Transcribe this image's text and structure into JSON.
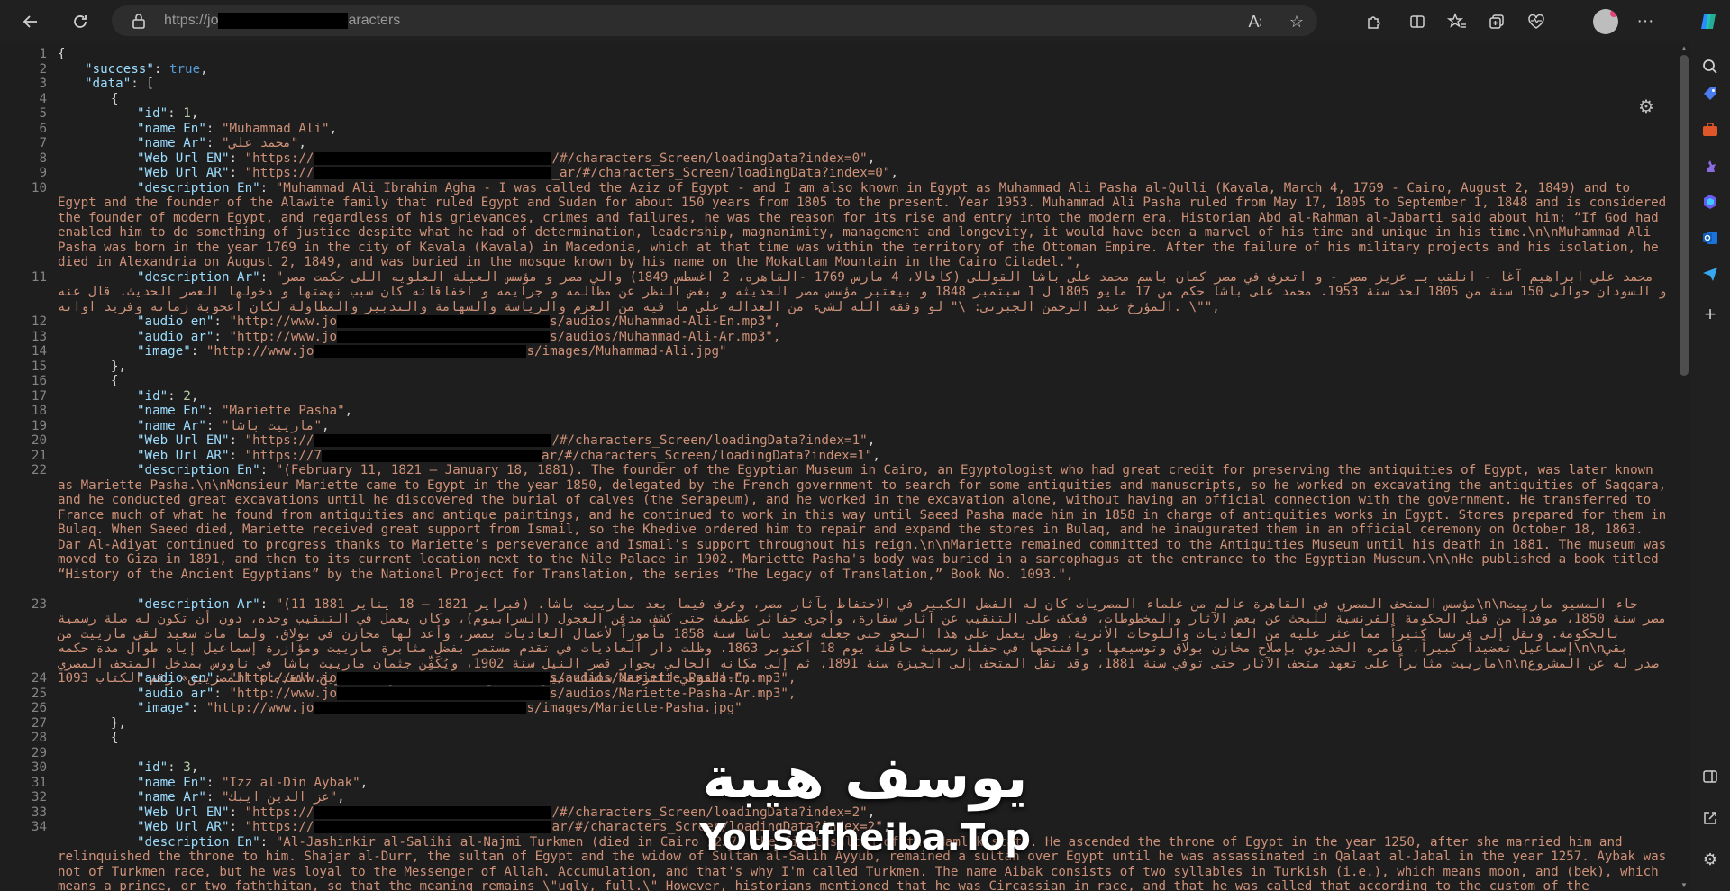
{
  "browser": {
    "url_prefix": "https://jo",
    "url_suffix": "aracters",
    "icons": {
      "back": "back-arrow-icon",
      "reload": "reload-icon",
      "lock": "lock-icon",
      "read_aloud": "read-aloud-icon",
      "favorite": "star-icon",
      "extensions": "puzzle-icon",
      "split": "split-screen-icon",
      "favorites": "favorites-icon",
      "collections": "collections-icon",
      "health": "browser-essentials-icon",
      "profile": "profile-avatar",
      "menu": "more-icon",
      "copilot": "copilot-icon"
    }
  },
  "sidebar": {
    "items": [
      "search-icon",
      "tag-icon",
      "briefcase-icon",
      "chess-icon",
      "copilot-app-icon",
      "outlook-icon",
      "send-icon",
      "add-icon"
    ],
    "bottom": [
      "sidebar-toggle-icon",
      "external-link-icon",
      "settings-icon"
    ]
  },
  "json_lines": {
    "l1": "{",
    "l2_key": "\"success\"",
    "l2_val": "true",
    "l3_key": "\"data\"",
    "l3_rest": "[",
    "l4": "{",
    "l5_key": "\"id\"",
    "l5_val": "1",
    "l6_key": "\"name En\"",
    "l6_val": "\"Muhammad Ali\"",
    "l7_key": "\"name Ar\"",
    "l7_val": "\"محمد علي\"",
    "l8_key": "\"Web Url EN\"",
    "l8_a": "\"https://",
    "l8_b": "/#/characters_Screen/loadingData?index=0\"",
    "l9_key": "\"Web Url AR\"",
    "l9_a": "\"https://",
    "l9_b": "_ar/#/characters_Screen/loadingData?index=0\"",
    "l10_key": "\"description En\"",
    "l10_val": "\"Muhammad Ali Ibrahim Agha - I was called the Aziz of Egypt - and I am also known in Egypt as Muhammad Ali Pasha al-Qulli (Kavala, March 4, 1769 - Cairo, August 2, 1849) and to Egypt and the founder of the Alawite family that ruled Egypt and Sudan for about 150 years from 1805 to the present. Year 1953. Muhammad Ali Pasha ruled from May 17, 1805 to September 1, 1848 and is considered the founder of modern Egypt, and regardless of his grievances, crimes and failures, he was the reason for its rise and entry into the modern era. Historian Abd al-Rahman al-Jabarti said about him: “If God had enabled him to do something of justice despite what he had of determination, leadership, magnanimity, management and longevity, it would have been a marvel of his time and unique in his time.\\n\\nMuhammad Ali Pasha was born in the year 1769 in the city of Kavala (Kavala) in Macedonia, which at that time was within the territory of the Ottoman Empire. After the failure of his military projects and his isolation, he died in Alexandria on August 2, 1849, and was buried in the mosque known by his name on the Mokattam Mountain in the Cairo Citadel.\",",
    "l11_key": "\"description Ar\"",
    "l11_val": "\"محمد علي ابراهيم آغا - انلقب بـ عزيز مصر - و اتعرف في مصر كمان باسم محمد على باشا القوللى (كافالا، 4 مارس 1769 -القاهره، 2 اغسطس 1849) والي مصر و مؤسس العيلة العلويه اللى حكمت مصر و السودان حوالى 150 سنة من 1805 لحد سنة 1953. محمد على باشا حكم من 17 مايو 1805 ل 1 سبتمبر 1848 و بيعتبر مؤسس مصر الحديثه و بغض النظر عن مظالمه و جرايمه و اخفاقاته كان سبب نهضتها و دخولها العصر الحديث. قال عنه المؤرخ عبد الرحمن الجبرتى: \\\" لو وفقه الله لشيء من العداله على ما فيه من العزم والرياسة والشهامة والتدبير والمطاولة لكان اعجوبة زمانه وفريد اوانه. \\\"\",",
    "l12_key": "\"audio en\"",
    "l12_a": "\"http://www.jo",
    "l12_b": "s/audios/Muhammad-Ali-En.mp3\",",
    "l13_key": "\"audio ar\"",
    "l13_a": "\"http://www.jo",
    "l13_b": "s/audios/Muhammad-Ali-Ar.mp3\",",
    "l14_key": "\"image\"",
    "l14_a": "\"http://www.jo",
    "l14_b": "s/images/Muhammad-Ali.jpg\"",
    "l15": "},",
    "l16": "{",
    "l17_key": "\"id\"",
    "l17_val": "2",
    "l18_key": "\"name En\"",
    "l18_val": "\"Mariette Pasha\"",
    "l19_key": "\"name Ar\"",
    "l19_val": "\"مارييت باشا\"",
    "l20_key": "\"Web Url EN\"",
    "l20_a": "\"https://",
    "l20_b": "/#/characters_Screen/loadingData?index=1\"",
    "l21_key": "\"Web Url AR\"",
    "l21_a": "\"https://7",
    "l21_b": "ar/#/characters_Screen/loadingData?index=1\"",
    "l22_key": "\"description En\"",
    "l22_val": "\"(February 11, 1821 – January 18, 1881). The founder of the Egyptian Museum in Cairo, an Egyptologist who had great credit for preserving the antiquities of Egypt, was later known as Mariette Pasha.\\n\\nMonsieur Mariette came to Egypt in the year 1850, delegated by the French government to search for some antiquities and manuscripts, so he worked on excavating the antiquities of Saqqara, and he conducted great excavations until he discovered the burial of calves (the Serapeum), and he worked in the excavation alone, without having an official connection with the government. He transferred to France much of what he found from antiquities and antique paintings, and he continued to work in this way until Saeed Pasha made him in 1858 in charge of antiquities works in Egypt. Stores prepared for them in Bulaq. When Saeed died, Mariette received great support from Ismail, so the Khedive ordered him to repair and expand the stores in Bulaq, and he inaugurated them in an official ceremony on October 18, 1863. Dar Al-Adiyat continued to progress thanks to Mariette’s perseverance and Ismail’s support throughout his reign.\\n\\nMariette remained committed to the Antiquities Museum until his death in 1881. The museum was moved to Giza in 1891, and then to its current location next to the Nile Palace in 1902. Mariette Pasha's body was buried in a sarcophagus at the entrance to the Egyptian Museum.\\n\\nHe published a book titled “History of the Ancient Egyptians” by the National Project for Translation, the series “The Legacy of Translation,” Book No. 1093.\",",
    "l23_key": "\"description Ar\"",
    "l23_val": "\"(11 فبراير 1821 – 18 يناير 1881) .مؤسس المتحف المصري في القاهرة عالم من علماء المصريات كان له الفضل الكبير في الاحتفاظ بآثار مصر، وعرف فيما بعد بمارييت باشا\\n\\nجاء المسيو مارييت مصر سنة 1850، موفداً من قبل الحكومة الفرنسية للبحث عن بعض الآثار والمخطوطات، فعكف على التنقيب عن آثار سقارة، وأجرى حفائر عظيمة حتى كشف مدفن العجول (السرابيوم)، وكان يعمل في التنقيب وحده، دون أن تكون له صلة رسمية بالحكومة. ونقل إلى فرنسا كثيراً مما عثر عليه من العاديات واللوحات الأثرية، وظل يعمل على هذا النحو حتى جعله سعيد باشا سنة 1858 مأموراً لأعمال العاديات بمصر، وأعد لها مخازن في بولاق. ولما مات سعيد لقي مارييت من إسماعيل تعضيداً كبيراً، فأمره الخديوي بإصلاح مخازن بولاق وتوسيعها، وافتتحها في حفلة رسمية حافلة يوم 18 أكتوبر 1863. وظلت دار العاديات في تقدم مستمر بفضل مثابرة مارييت ومؤازرة إسماعيل إياه طوال مدة حكمه\\n\\nبقي مارييت مثابراً على تعهد متحف الآثار حتى توفي سنة 1881، وقد نقل المتحف إلى الجيزة سنة 1891، ثم إلى مكانه الحالي بجوار قصر النيل سنة 1902، ويُكَفِّن جثمان مارييت باشا في ناووس بمدخل المتحف المصري\\n\\nصدر له عن المشروع القومي للترجمة سلسلة ميراث الترجمة كتاب بعنوان «تاريخ القدماء المصريين» رقم الكتاب 1093.\",",
    "l24_key": "\"audio en\"",
    "l24_a": "\"http://www.jo",
    "l24_b": "s/audios/Mariette-Pasha-En.mp3\",",
    "l25_key": "\"audio ar\"",
    "l25_a": "\"http://www.jo",
    "l25_b": "s/audios/Mariette-Pasha-Ar.mp3\",",
    "l26_key": "\"image\"",
    "l26_a": "\"http://www.jo",
    "l26_b": "s/images/Mariette-Pasha.jpg\"",
    "l27": "},",
    "l28": "{",
    "l30_key": "\"id\"",
    "l30_val": "3",
    "l31_key": "\"name En\"",
    "l31_val": "\"Izz al-Din Aybak\"",
    "l32_key": "\"name Ar\"",
    "l32_val": "\"عز الدين ايبك\"",
    "l33_key": "\"Web Url EN\"",
    "l33_a": "\"https://",
    "l33_b": "/#/characters_Screen/loadingData?index=2\"",
    "l34_key": "\"Web Url AR\"",
    "l34_a": "\"https://",
    "l34_b": "ar/#/characters_Screen/loadingData?index=2\"",
    "l35_key": "\"description En\"",
    "l35_val": "\"Al-Jashinkir al-Salihi al-Najmi Turkmen (died in Cairo 1257) the first sultan of the Mamluk state. He ascended the throne of Egypt in the year 1250, after she married him and relinquished the throne to him. Shajar al-Durr, the sultan of Egypt and the widow of Sultan al-Salih Ayyub, remained a sultan over Egypt until he was assassinated in Qalaat al-Jabal in the year 1257. Aybak was not of Turkmen race, but he was loyal to the Messenger of Allah. Accumulation, and that's why I'm called Turkmen. The name Aibak consists of two syllables in Turkish (i.e.), which means moon, and (bek), which means a prince, or two faththitan, so that the meaning remains \\\"ugly, full.\\\" However, historians mentioned that he was Circassian in race, and that he was called that according to the custom of the Circassians who used to name their children after them.\""
  },
  "line_numbers": [
    "1",
    "2",
    "3",
    "4",
    "5",
    "6",
    "7",
    "8",
    "9",
    "10",
    "11",
    "12",
    "13",
    "14",
    "15",
    "16",
    "17",
    "18",
    "19",
    "20",
    "21",
    "22",
    "23",
    "24",
    "25",
    "26",
    "27",
    "28",
    "29",
    "30",
    "31",
    "32",
    "33",
    "34"
  ],
  "watermark": {
    "arabic": "يوسف هيبة",
    "english": "Yousefheiba.Top"
  }
}
